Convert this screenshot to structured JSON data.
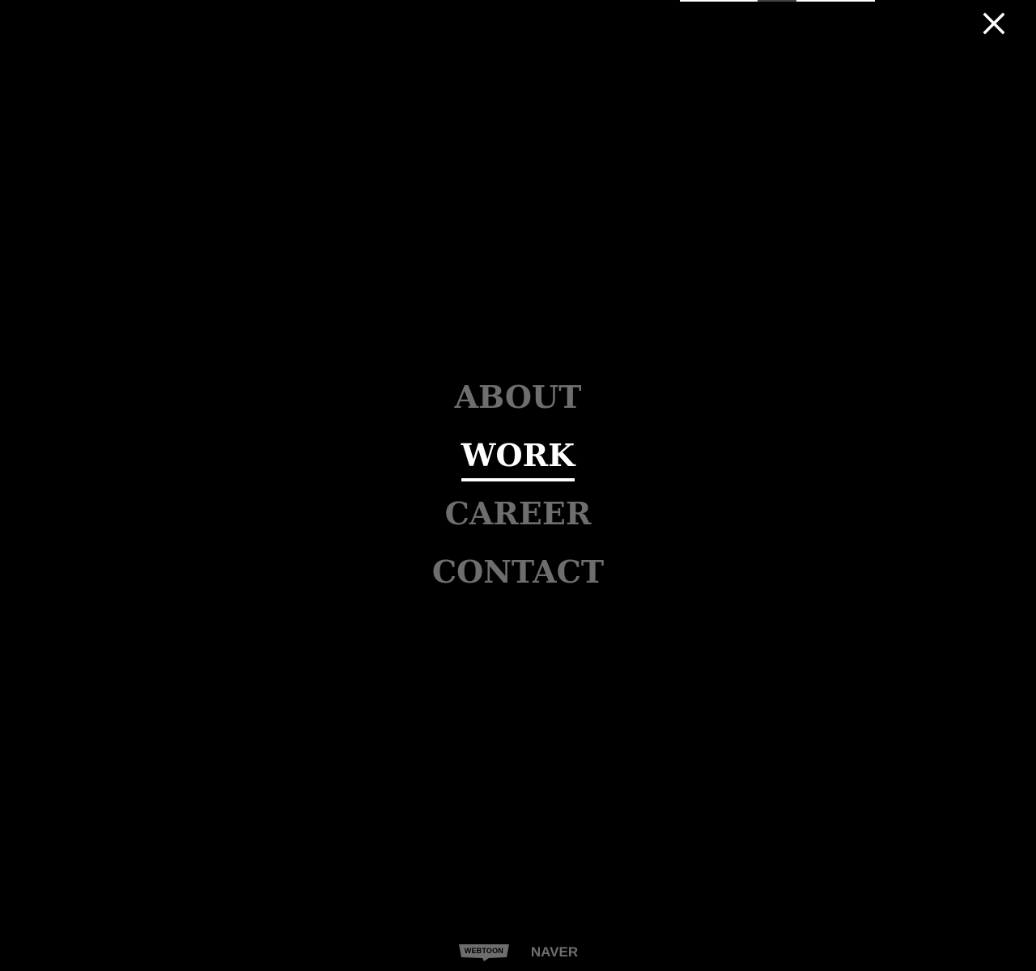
{
  "header": {
    "close_icon": "close-icon",
    "close_label": "Close menu"
  },
  "nav": {
    "active_item": "WORK",
    "items": [
      {
        "label": "ABOUT",
        "active": false
      },
      {
        "label": "WORK",
        "active": true
      },
      {
        "label": "CAREER",
        "active": false
      },
      {
        "label": "CONTACT",
        "active": false
      }
    ]
  },
  "footer": {
    "logos": [
      {
        "label": "WEBTOON",
        "icon": "webtoon-logo"
      },
      {
        "label": "NAVER",
        "icon": "naver-logo"
      }
    ]
  },
  "colors": {
    "background": "#000000",
    "active": "#ffffff",
    "inactive": "#6e6e6e"
  }
}
